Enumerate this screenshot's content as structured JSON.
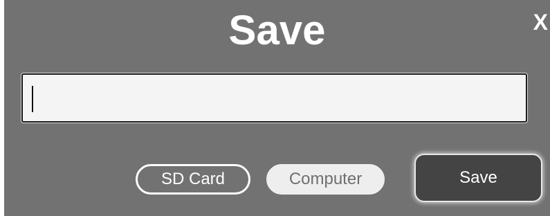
{
  "dialog": {
    "title": "Save",
    "close_label": "X"
  },
  "filename_input": {
    "value": "",
    "placeholder": ""
  },
  "destinations": {
    "sd_card_label": "SD Card",
    "computer_label": "Computer",
    "selected": "SD Card"
  },
  "actions": {
    "save_label": "Save"
  },
  "colors": {
    "dialog_background": "#727272",
    "input_background": "#f4f4f4",
    "save_button_background": "#444444",
    "inactive_pill_background": "#eeeeee"
  }
}
